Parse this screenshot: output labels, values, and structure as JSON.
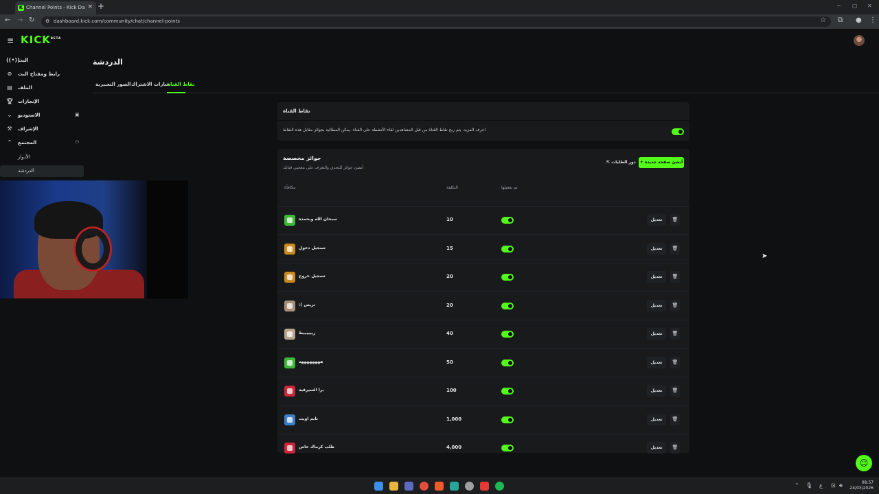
{
  "browser": {
    "tab_title": "Channel Points - Kick Dashboar",
    "url": "dashboard.kick.com/community/chat/channel-points"
  },
  "brand": {
    "logo": "KICK",
    "logo_badge": "BETA",
    "accent": "#53fc18"
  },
  "sidebar": {
    "items": [
      {
        "label": "البث",
        "icon": "broadcast-icon"
      },
      {
        "label": "رابط ومفتاح البث",
        "icon": "link-icon"
      },
      {
        "label": "الملف",
        "icon": "profile-icon"
      },
      {
        "label": "الإنجازات",
        "icon": "trophy-icon"
      },
      {
        "label": "الاستوديو",
        "icon": "chevron-down-icon"
      },
      {
        "label": "الإشراف",
        "icon": "moderation-icon"
      },
      {
        "label": "المجتمع",
        "icon": "chevron-up-icon"
      }
    ],
    "sub_items": [
      {
        "label": "الأدوار"
      },
      {
        "label": "الدردشة"
      }
    ]
  },
  "main": {
    "title": "الدردشة",
    "tabs": [
      {
        "label": "الصور التعبيرية"
      },
      {
        "label": "شارات الاشتراك"
      },
      {
        "label": "نقاط القناة"
      }
    ]
  },
  "channel_points_card": {
    "heading": "نقاط القناة",
    "description": "اعرف المزيد. يتم ربح نقاط القناة من قبل المشاهدين لقاء الأنشطة على القناة. يمكن المطالبة بجوائز مقابل هذه النقاط",
    "enabled": true
  },
  "rewards_card": {
    "heading": "جوائز مخصصة",
    "subheading": "أنشئ جوائز للتحدي والتعرف على معجبي قناتك",
    "requests_button": "دور الطلبات",
    "new_button": "أنشئ صفحة جديدة",
    "columns": {
      "reward": "مكافأة",
      "cost": "التكلفة",
      "enabled": "تم تفعيلها"
    },
    "edit_label": "تعديل",
    "rows": [
      {
        "name": "سبحان الله وبحمده",
        "cost": "10",
        "color": "#3fb83a",
        "enabled": true
      },
      {
        "name": "تسجيل دخول",
        "cost": "15",
        "color": "#c98a1e",
        "enabled": true
      },
      {
        "name": "تسجيل خروج",
        "cost": "20",
        "color": "#c98a1e",
        "enabled": true
      },
      {
        "name": ":( تريس",
        "cost": "20",
        "color": "#a88f78",
        "enabled": true
      },
      {
        "name": "زييييييط",
        "cost": "40",
        "color": "#b8a48a",
        "enabled": true
      },
      {
        "name": "ههههههههه",
        "cost": "50",
        "color": "#3fb83a",
        "enabled": true
      },
      {
        "name": "برا السيرفية",
        "cost": "100",
        "color": "#c9273a",
        "enabled": true
      },
      {
        "name": "تايم اويت",
        "cost": "1,000",
        "color": "#3c7fc4",
        "enabled": true
      },
      {
        "name": "طلب كرماك خاص",
        "cost": "4,000",
        "color": "#c9273a",
        "enabled": true
      }
    ]
  },
  "taskbar": {
    "time": "08:57",
    "date": "24/03/2026"
  }
}
